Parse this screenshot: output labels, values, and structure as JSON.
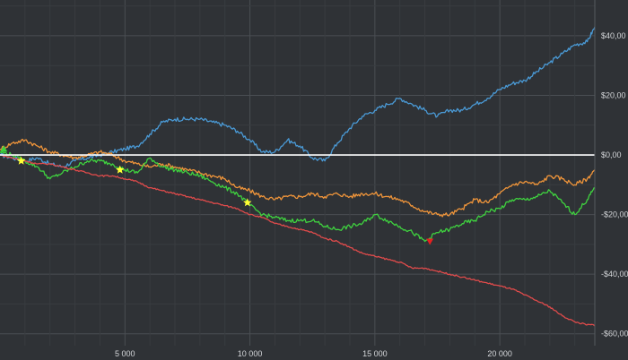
{
  "chart_data": {
    "type": "line",
    "title": "",
    "xlabel": "",
    "ylabel": "",
    "xlim": [
      0,
      23800
    ],
    "ylim": [
      -64,
      52
    ],
    "grid": true,
    "x_ticks": [
      5000,
      10000,
      15000,
      20000
    ],
    "x_tick_labels": [
      "5 000",
      "10 000",
      "15 000",
      "20 000"
    ],
    "y_ticks": [
      40,
      20,
      0,
      -20,
      -40,
      -60
    ],
    "y_tick_labels": [
      "$40,00",
      "$20,00",
      "$0,00",
      "-$20,00",
      "-$40,00",
      "-$60,00"
    ],
    "zero_line": 0,
    "colors": {
      "background": "#2f3236",
      "grid": "#4a4e53",
      "zero_line": "#ffffff",
      "blue": "#4a9ad6",
      "orange": "#f0953a",
      "green": "#3fd23f",
      "red": "#e04b4b",
      "star": "#ffff33",
      "down_marker": "#e82020",
      "start_marker": "#3fd23f"
    },
    "series": [
      {
        "color_key": "blue",
        "x": [
          0,
          500,
          1000,
          1500,
          2000,
          2500,
          3000,
          3500,
          4000,
          4500,
          5000,
          5500,
          6000,
          6500,
          7000,
          7500,
          8000,
          8500,
          9000,
          9500,
          10000,
          10500,
          11000,
          11500,
          12000,
          12500,
          13000,
          13500,
          14000,
          14500,
          15000,
          15500,
          16000,
          16500,
          17000,
          17500,
          18000,
          18500,
          19000,
          19500,
          20000,
          20500,
          21000,
          21500,
          22000,
          22500,
          23000,
          23500,
          23800
        ],
        "y": [
          0,
          -1,
          -2,
          -1,
          -3,
          -4,
          -2,
          -1,
          0,
          1,
          2,
          3,
          7,
          11,
          12,
          12,
          12,
          11,
          10,
          8,
          5,
          1,
          1,
          5,
          3,
          -1,
          -2,
          4,
          9,
          13,
          15,
          17,
          19,
          17,
          15,
          13,
          15,
          15,
          17,
          19,
          22,
          24,
          25,
          28,
          31,
          34,
          37,
          38,
          43
        ]
      },
      {
        "color_key": "orange",
        "x": [
          0,
          500,
          1000,
          1500,
          2000,
          2500,
          3000,
          3500,
          4000,
          4500,
          5000,
          5500,
          6000,
          6500,
          7000,
          7500,
          8000,
          8500,
          9000,
          9500,
          10000,
          10500,
          11000,
          11500,
          12000,
          12500,
          13000,
          13500,
          14000,
          14500,
          15000,
          15500,
          16000,
          16500,
          17000,
          17500,
          18000,
          18500,
          19000,
          19500,
          20000,
          20500,
          21000,
          21500,
          22000,
          22500,
          23000,
          23500,
          23800
        ],
        "y": [
          2,
          4,
          5,
          3,
          1,
          0,
          -1,
          0,
          1,
          0,
          -2,
          -3,
          -4,
          -3,
          -4,
          -5,
          -6,
          -7,
          -8,
          -11,
          -12,
          -14,
          -15,
          -14,
          -14,
          -13,
          -14,
          -13,
          -14,
          -13,
          -13,
          -14,
          -15,
          -17,
          -19,
          -20,
          -20,
          -18,
          -15,
          -16,
          -13,
          -10,
          -9,
          -10,
          -7,
          -8,
          -10,
          -8,
          -5
        ]
      },
      {
        "color_key": "green",
        "x": [
          0,
          500,
          1000,
          1500,
          2000,
          2500,
          3000,
          3500,
          4000,
          4500,
          5000,
          5500,
          6000,
          6500,
          7000,
          7500,
          8000,
          8500,
          9000,
          9500,
          10000,
          10500,
          11000,
          11500,
          12000,
          12500,
          13000,
          13500,
          14000,
          14500,
          15000,
          15500,
          16000,
          16500,
          17000,
          17500,
          18000,
          18500,
          19000,
          19500,
          20000,
          20500,
          21000,
          21500,
          22000,
          22500,
          23000,
          23500,
          23800
        ],
        "y": [
          1,
          0,
          -2,
          -4,
          -8,
          -6,
          -4,
          -2,
          -2,
          -3,
          -5,
          -6,
          -1,
          -4,
          -5,
          -6,
          -7,
          -9,
          -11,
          -13,
          -17,
          -20,
          -21,
          -22,
          -22,
          -22,
          -24,
          -25,
          -24,
          -23,
          -20,
          -22,
          -24,
          -26,
          -29,
          -26,
          -25,
          -23,
          -22,
          -19,
          -18,
          -15,
          -15,
          -14,
          -12,
          -16,
          -20,
          -15,
          -11
        ]
      },
      {
        "color_key": "red",
        "x": [
          0,
          500,
          1000,
          1500,
          2000,
          2500,
          3000,
          3500,
          4000,
          4500,
          5000,
          5500,
          6000,
          6500,
          7000,
          7500,
          8000,
          8500,
          9000,
          9500,
          10000,
          10500,
          11000,
          11500,
          12000,
          12500,
          13000,
          13500,
          14000,
          14500,
          15000,
          15500,
          16000,
          16500,
          17000,
          17500,
          18000,
          18500,
          19000,
          19500,
          20000,
          20500,
          21000,
          21500,
          22000,
          22500,
          23000,
          23500,
          23800
        ],
        "y": [
          0,
          -1,
          -2,
          -3,
          -3,
          -4,
          -5,
          -6,
          -7,
          -7,
          -8,
          -9,
          -11,
          -12,
          -13,
          -14,
          -15,
          -16,
          -17,
          -18,
          -20,
          -21,
          -23,
          -24,
          -25,
          -26,
          -28,
          -29,
          -31,
          -33,
          -34,
          -35,
          -36,
          -38,
          -38,
          -39,
          -40,
          -41,
          -42,
          -43,
          -44,
          -45,
          -47,
          -49,
          -51,
          -54,
          -56,
          -57,
          -57
        ]
      }
    ],
    "markers": [
      {
        "type": "triangle-up",
        "color_key": "start_marker",
        "x": 150,
        "y": 2
      },
      {
        "type": "star",
        "color_key": "star",
        "x": 850,
        "y": -2
      },
      {
        "type": "star",
        "color_key": "star",
        "x": 4800,
        "y": -5
      },
      {
        "type": "star",
        "color_key": "star",
        "x": 9900,
        "y": -16
      },
      {
        "type": "triangle-down",
        "color_key": "down_marker",
        "x": 17200,
        "y": -29
      }
    ]
  }
}
